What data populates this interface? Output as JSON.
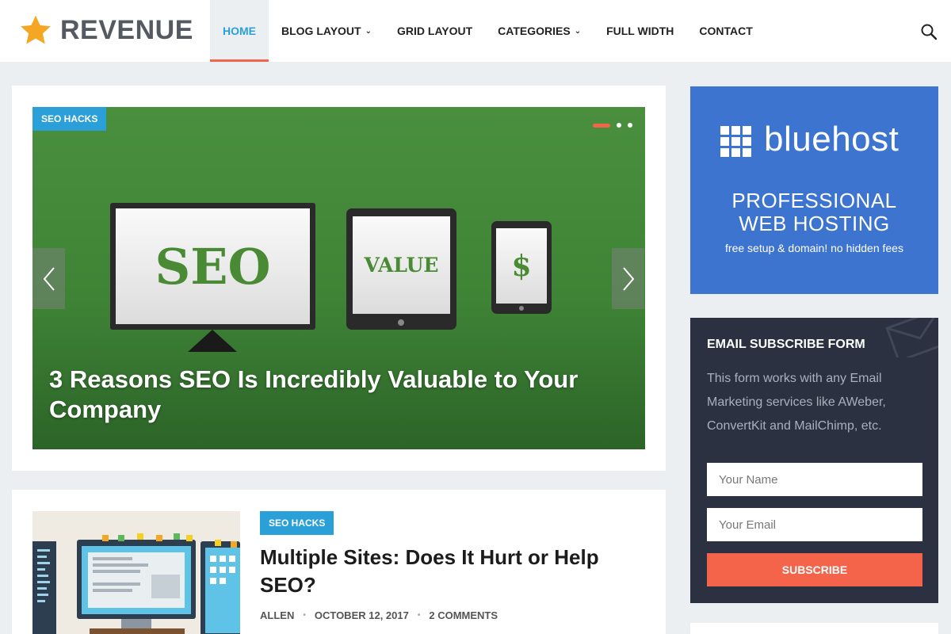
{
  "header": {
    "logo_text": "REVENUE",
    "nav": [
      {
        "label": "HOME",
        "active": true,
        "dropdown": false
      },
      {
        "label": "BLOG LAYOUT",
        "active": false,
        "dropdown": true
      },
      {
        "label": "GRID LAYOUT",
        "active": false,
        "dropdown": false
      },
      {
        "label": "CATEGORIES",
        "active": false,
        "dropdown": true
      },
      {
        "label": "FULL WIDTH",
        "active": false,
        "dropdown": false
      },
      {
        "label": "CONTACT",
        "active": false,
        "dropdown": false
      }
    ],
    "search_icon": "search-icon",
    "logo_icon": "star-icon"
  },
  "slider": {
    "category": "SEO HACKS",
    "title": "3 Reasons SEO Is Incredibly Valuable to Your Company",
    "slide_count": 3,
    "active_slide": 1,
    "image_texts": {
      "monitor": "SEO",
      "tablet": "VALUE",
      "phone": "$"
    }
  },
  "post": {
    "category": "SEO HACKS",
    "title": "Multiple Sites: Does It Hurt or Help SEO?",
    "author": "ALLEN",
    "date": "OCTOBER 12, 2017",
    "comments": "2 COMMENTS"
  },
  "ad": {
    "brand": "bluehost",
    "headline_line1": "PROFESSIONAL",
    "headline_line2": "WEB HOSTING",
    "subtext": "free setup & domain! no hidden fees"
  },
  "subscribe": {
    "title": "EMAIL SUBSCRIBE FORM",
    "description": "This form works with any Email Marketing services like AWeber, ConvertKit and MailChimp, etc.",
    "name_placeholder": "Your Name",
    "email_placeholder": "Your Email",
    "button_label": "SUBSCRIBE"
  },
  "colors": {
    "accent_blue": "#2a9fd8",
    "accent_orange": "#f4644a",
    "star": "#f5a623",
    "ad_blue": "#3d74d0",
    "form_bg": "#2b3140"
  }
}
